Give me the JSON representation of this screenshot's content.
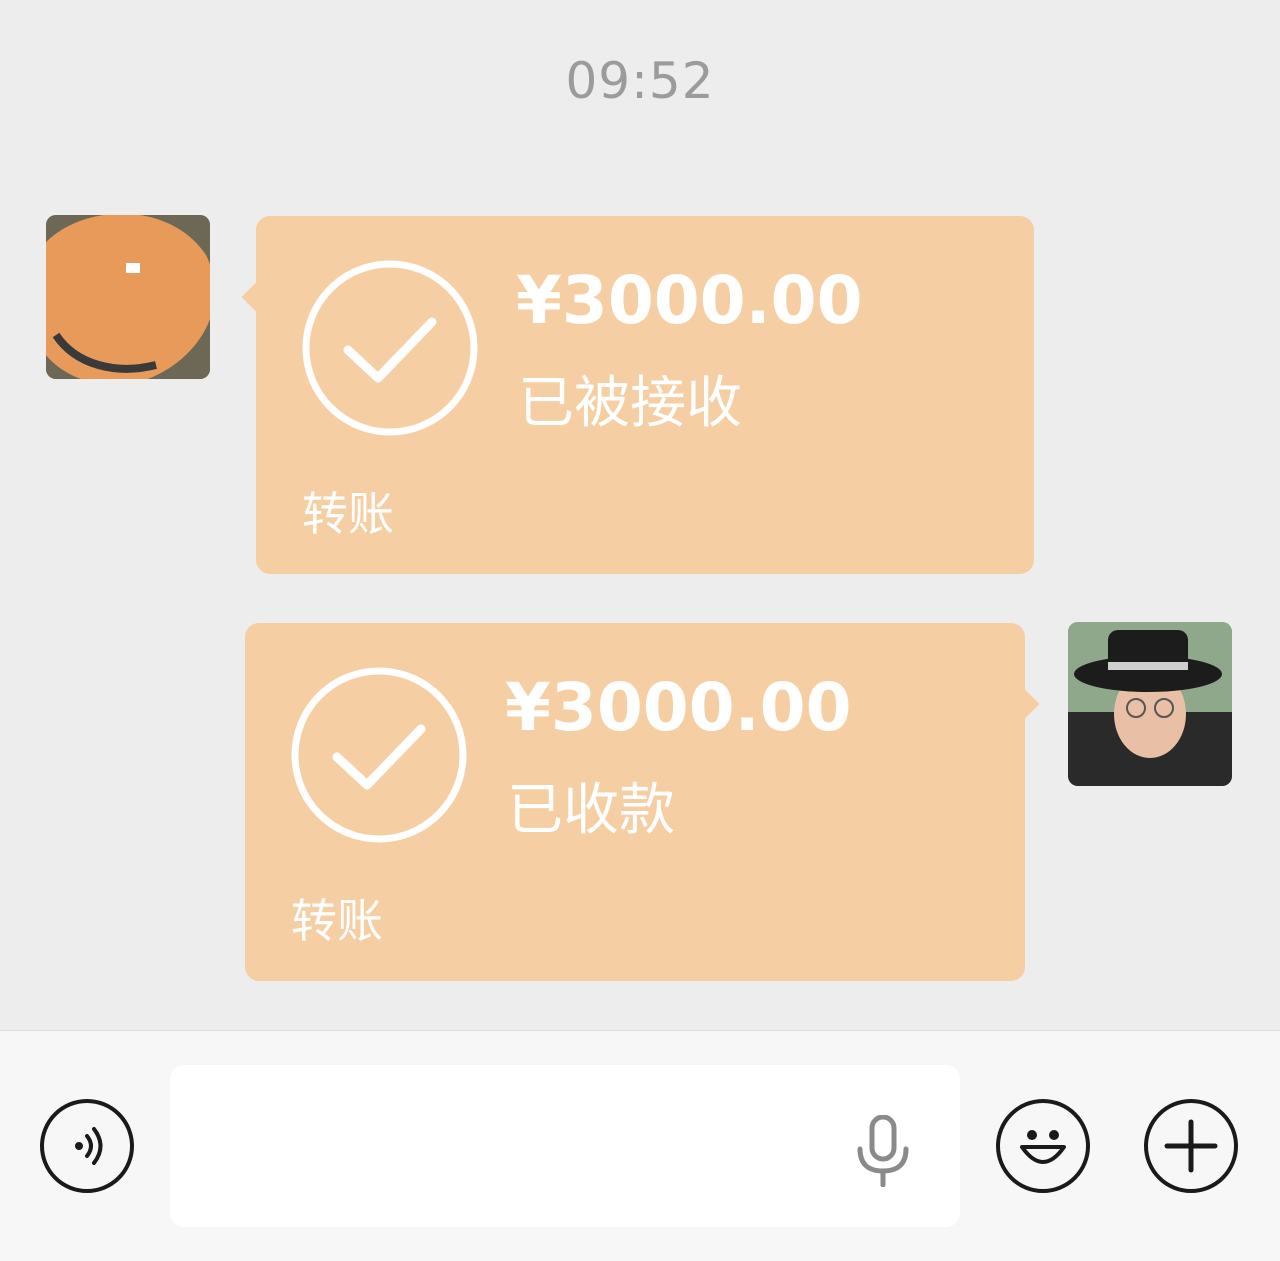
{
  "chat": {
    "timestamp": "09:52",
    "messages": [
      {
        "side": "left",
        "type": "transfer",
        "amount": "¥3000.00",
        "status": "已被接收",
        "label": "转账"
      },
      {
        "side": "right",
        "type": "transfer",
        "amount": "¥3000.00",
        "status": "已收款",
        "label": "转账"
      }
    ]
  },
  "colors": {
    "background": "#ededed",
    "bubble": "#f5cfa3",
    "scribble": "#e89a5a"
  },
  "input_bar": {
    "text_value": "",
    "icons": [
      "voice-icon",
      "microphone-icon",
      "emoji-icon",
      "plus-icon"
    ]
  }
}
